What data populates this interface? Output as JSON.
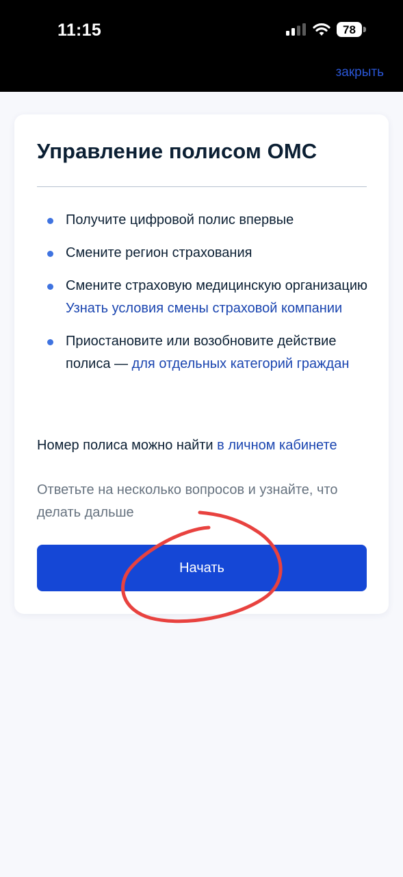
{
  "status_bar": {
    "time": "11:15",
    "battery_level": "78"
  },
  "header": {
    "close_label": "закрыть"
  },
  "card": {
    "title": "Управление полисом ОМС",
    "bullets": [
      {
        "text": "Получите цифровой полис впервые"
      },
      {
        "text": "Смените регион страхования"
      },
      {
        "text": "Смените страховую медицинскую организацию",
        "link": "Узнать условия смены страховой компании"
      },
      {
        "text": "Приостановите или возобновите действие полиса — ",
        "link": "для отдельных категорий граждан"
      }
    ],
    "policy_note_text": "Номер полиса можно найти ",
    "policy_note_link": "в личном кабинете",
    "hint": "Ответьте на несколько вопросов и узнайте, что делать дальше",
    "start_button": "Начать"
  },
  "colors": {
    "accent": "#1547d6",
    "link": "#1a45b0",
    "bullet": "#3f73e0",
    "annotation": "#e8423f"
  }
}
